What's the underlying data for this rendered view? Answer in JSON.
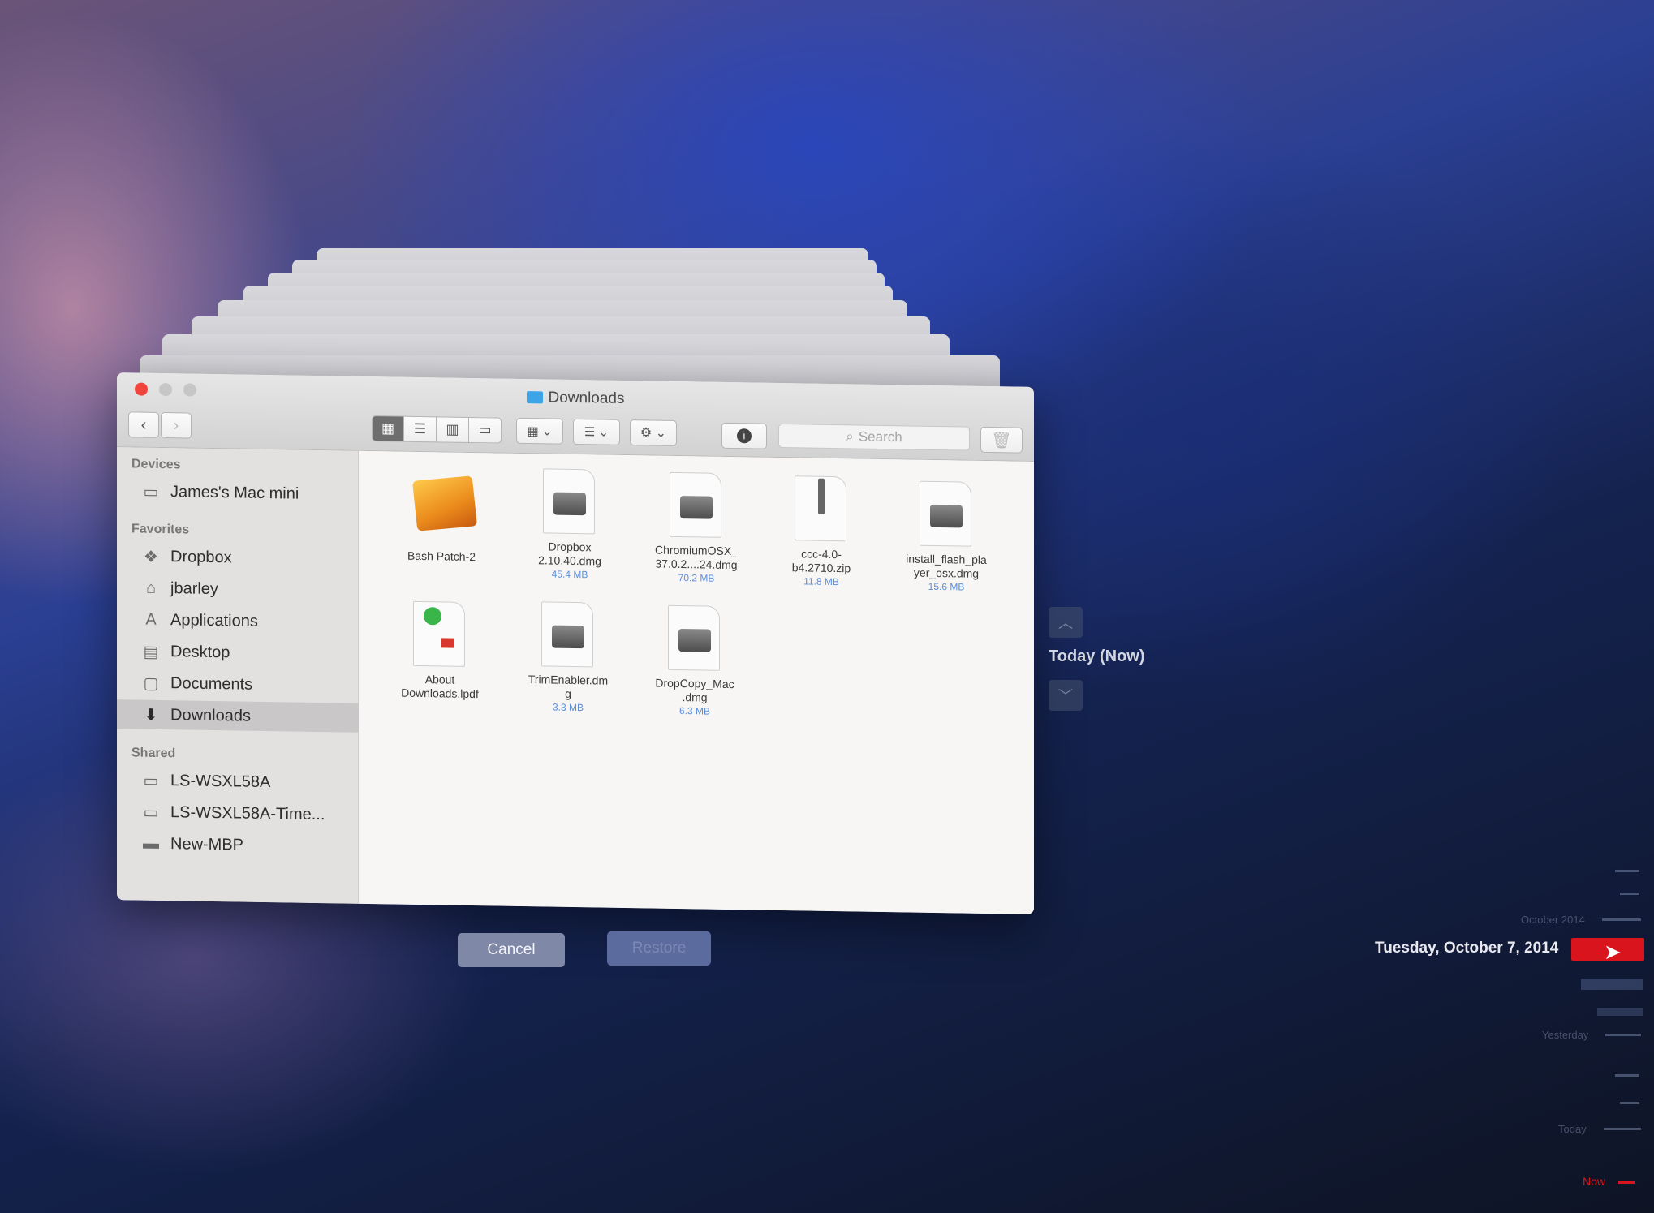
{
  "window": {
    "title": "Downloads"
  },
  "toolbar": {
    "back": "‹",
    "forward": "›",
    "search_placeholder": "Search"
  },
  "sidebar": {
    "sections": [
      {
        "label": "Devices",
        "items": [
          {
            "label": "James's Mac mini",
            "icon": "mac-mini-icon"
          }
        ]
      },
      {
        "label": "Favorites",
        "items": [
          {
            "label": "Dropbox",
            "icon": "dropbox-icon"
          },
          {
            "label": "jbarley",
            "icon": "home-icon"
          },
          {
            "label": "Applications",
            "icon": "applications-icon"
          },
          {
            "label": "Desktop",
            "icon": "desktop-icon"
          },
          {
            "label": "Documents",
            "icon": "documents-icon"
          },
          {
            "label": "Downloads",
            "icon": "downloads-icon",
            "selected": true
          }
        ]
      },
      {
        "label": "Shared",
        "items": [
          {
            "label": "LS-WSXL58A",
            "icon": "network-display-icon"
          },
          {
            "label": "LS-WSXL58A-Time...",
            "icon": "network-display-icon"
          },
          {
            "label": "New-MBP",
            "icon": "laptop-icon"
          }
        ]
      }
    ]
  },
  "files": [
    {
      "name": "Bash Patch-2",
      "name2": "",
      "size": "",
      "kind": "package"
    },
    {
      "name": "Dropbox",
      "name2": "2.10.40.dmg",
      "size": "45.4 MB",
      "kind": "dmg"
    },
    {
      "name": "ChromiumOSX_",
      "name2": "37.0.2....24.dmg",
      "size": "70.2 MB",
      "kind": "dmg"
    },
    {
      "name": "ccc-4.0-",
      "name2": "b4.2710.zip",
      "size": "11.8 MB",
      "kind": "zip"
    },
    {
      "name": "install_flash_pla",
      "name2": "yer_osx.dmg",
      "size": "15.6 MB",
      "kind": "dmg"
    },
    {
      "name": "About",
      "name2": "Downloads.lpdf",
      "size": "",
      "kind": "pdf"
    },
    {
      "name": "TrimEnabler.dm",
      "name2": "g",
      "size": "3.3 MB",
      "kind": "dmg"
    },
    {
      "name": "DropCopy_Mac",
      "name2": ".dmg",
      "size": "6.3 MB",
      "kind": "dmg"
    }
  ],
  "buttons": {
    "cancel": "Cancel",
    "restore": "Restore"
  },
  "timeline": {
    "current_label": "Today (Now)",
    "selected_date": "Tuesday, October 7, 2014",
    "marks": [
      "October 2014",
      "Yesterday",
      "Today"
    ],
    "now_label": "Now",
    "accent_color": "#d9141c"
  }
}
